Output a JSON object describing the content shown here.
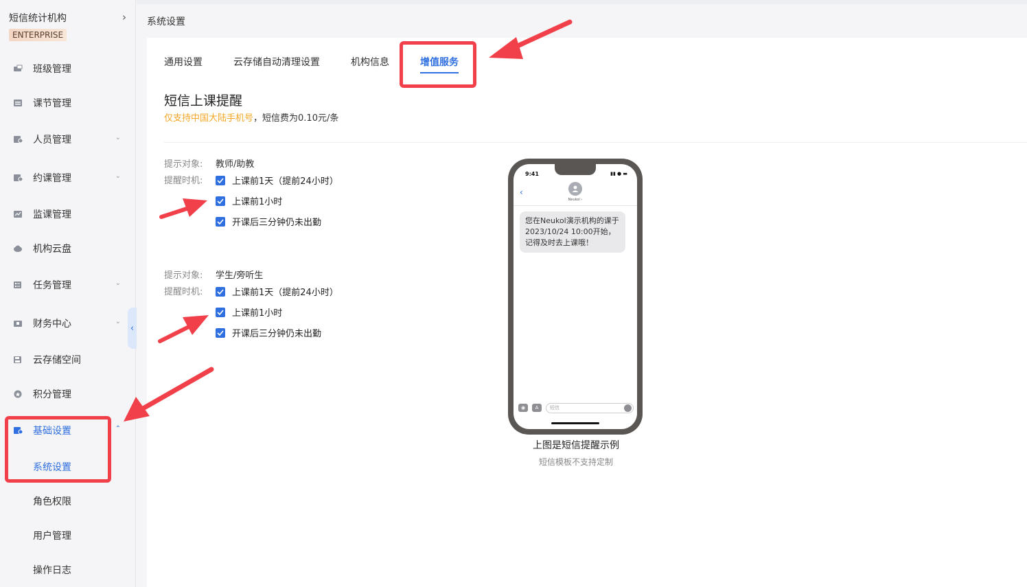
{
  "sidebar": {
    "org_name": "短信统计机构",
    "org_badge": "ENTERPRISE",
    "items": [
      {
        "label": "班级管理",
        "icon": "class-icon"
      },
      {
        "label": "课节管理",
        "icon": "lesson-icon"
      },
      {
        "label": "人员管理",
        "icon": "people-icon"
      },
      {
        "label": "约课管理",
        "icon": "booking-icon"
      },
      {
        "label": "监课管理",
        "icon": "monitor-icon"
      },
      {
        "label": "机构云盘",
        "icon": "cloud-icon"
      },
      {
        "label": "任务管理",
        "icon": "task-icon"
      },
      {
        "label": "财务中心",
        "icon": "finance-icon"
      },
      {
        "label": "云存储空间",
        "icon": "storage-icon"
      },
      {
        "label": "积分管理",
        "icon": "points-icon"
      },
      {
        "label": "基础设置",
        "icon": "settings-icon"
      }
    ],
    "sub_items": [
      "系统设置",
      "角色权限",
      "用户管理",
      "操作日志"
    ]
  },
  "breadcrumb": "系统设置",
  "tabs": [
    "通用设置",
    "云存储自动清理设置",
    "机构信息",
    "增值服务"
  ],
  "sms": {
    "title": "短信上课提醒",
    "note_warn": "仅支持中国大陆手机号",
    "note_rest": "，短信费为0.10元/条",
    "target_label": "提示对象:",
    "timing_label": "提醒时机:",
    "groups": [
      {
        "target": "教师/助教",
        "options": [
          "上课前1天（提前24小时）",
          "上课前1小时",
          "开课后三分钟仍未出勤"
        ],
        "checked": [
          true,
          true,
          true
        ]
      },
      {
        "target": "学生/旁听生",
        "options": [
          "上课前1天（提前24小时）",
          "上课前1小时",
          "开课后三分钟仍未出勤"
        ],
        "checked": [
          true,
          true,
          true
        ]
      }
    ]
  },
  "phone": {
    "time": "9:41",
    "contact": "Neukol ›",
    "message": "您在Neukol演示机构的课于2023/10/24 10:00开始，记得及时去上课哦！",
    "input_placeholder": "短信"
  },
  "caption": "上图是短信提醒示例",
  "subcaption": "短信模板不支持定制",
  "colors": {
    "accent": "#2f6fe0",
    "warn": "#f5a623",
    "annotation": "#f1404a"
  }
}
